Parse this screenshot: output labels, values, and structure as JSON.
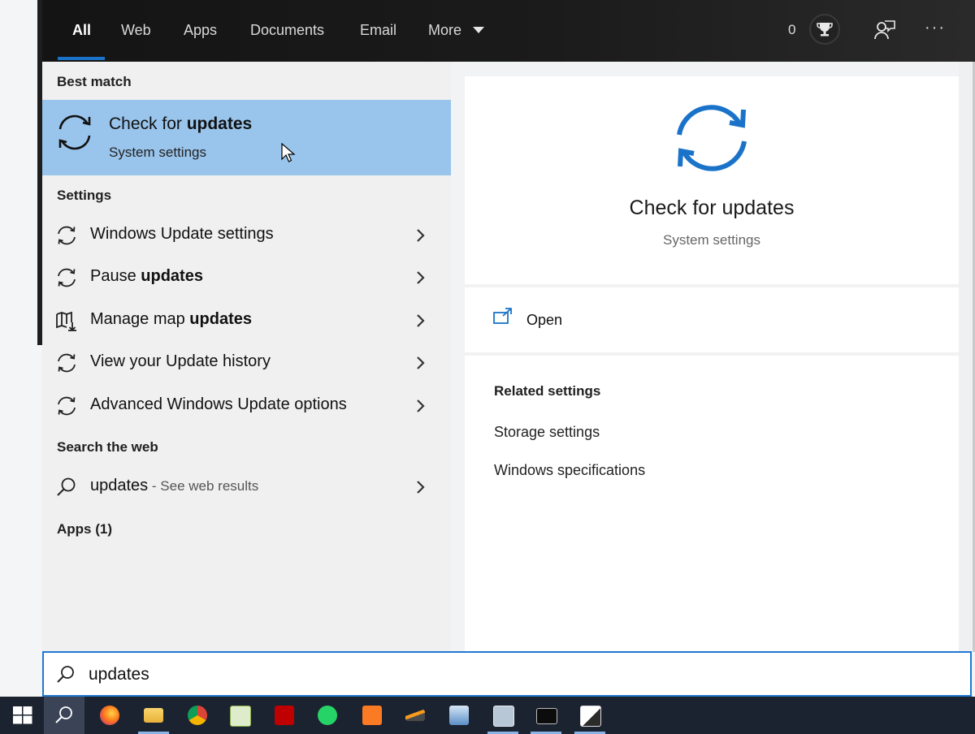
{
  "nav": {
    "tabs": [
      {
        "label": "All",
        "active": true
      },
      {
        "label": "Web"
      },
      {
        "label": "Apps"
      },
      {
        "label": "Documents"
      },
      {
        "label": "Email"
      },
      {
        "label": "More"
      }
    ],
    "points": "0",
    "icons": [
      "trophy-icon",
      "feedback-icon",
      "more-options-icon"
    ]
  },
  "results": {
    "best_match_label": "Best match",
    "best_match": {
      "title_prefix": "Check for ",
      "title_bold": "updates",
      "subtitle": "System settings",
      "icon": "refresh-icon"
    },
    "settings_label": "Settings",
    "settings": [
      {
        "prefix": "Windows Update settings",
        "bold": "",
        "icon": "refresh-icon"
      },
      {
        "prefix": "Pause ",
        "bold": "updates",
        "icon": "refresh-icon"
      },
      {
        "prefix": "Manage map ",
        "bold": "updates",
        "icon": "map-icon"
      },
      {
        "prefix": "View your Update history",
        "bold": "",
        "icon": "refresh-icon"
      },
      {
        "prefix": "Advanced Windows Update options",
        "bold": "",
        "icon": "refresh-icon"
      }
    ],
    "web_label": "Search the web",
    "web": {
      "query": "updates",
      "suffix": " - See web results"
    },
    "apps_label": "Apps (1)"
  },
  "preview": {
    "title": "Check for updates",
    "subtitle": "System settings",
    "open_label": "Open",
    "related_title": "Related settings",
    "related_links": [
      "Storage settings",
      "Windows specifications"
    ]
  },
  "search": {
    "value": "updates"
  },
  "taskbar": {
    "apps": [
      "start",
      "search",
      "firefox",
      "file-explorer",
      "chrome",
      "notepad-plus-plus",
      "filezilla",
      "whatsapp",
      "xampp",
      "sublime-text",
      "remote-desktop",
      "network-monitor",
      "terminal",
      "photos"
    ]
  },
  "colors": {
    "accent": "#1a73c9",
    "selection": "#99c4eb",
    "nav_bg": "#1b1b1b"
  }
}
